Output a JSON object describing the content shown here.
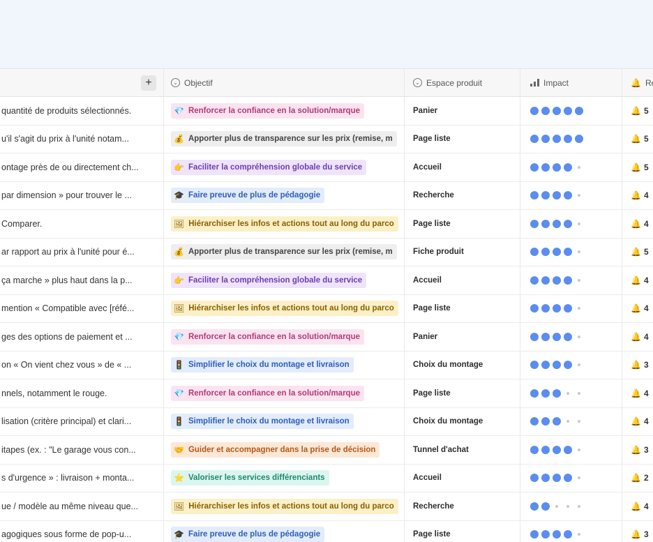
{
  "header": {
    "add_label": "+",
    "objectif": "Objectif",
    "espace": "Espace produit",
    "impact": "Impact",
    "re": "Re"
  },
  "icons": {
    "objectif": "circle-chevron-icon",
    "espace": "circle-chevron-icon",
    "impact": "bar-chart-icon",
    "re": "bell-icon"
  },
  "colors": {
    "accent_dot": "#5b8def",
    "top_band": "#f1f5fc"
  },
  "rows": [
    {
      "desc": "quantité de produits sélectionnés.",
      "emoji": "💎",
      "objectif": "Renforcer la confiance en la solution/marque",
      "tag_bg": "#fbe4ef",
      "tag_fg": "#b23b76",
      "espace": "Panier",
      "impact": 5,
      "re": "5"
    },
    {
      "desc": "u'il s'agit du prix à l'unité notam...",
      "emoji": "💰",
      "objectif": "Apporter plus de transparence sur les prix (remise, m",
      "tag_bg": "#eeeeee",
      "tag_fg": "#444444",
      "espace": "Page liste",
      "impact": 5,
      "re": "5"
    },
    {
      "desc": "ontage près de ou directement ch...",
      "emoji": "👉",
      "objectif": "Faciliter la compréhension globale du service",
      "tag_bg": "#efe4fb",
      "tag_fg": "#6b3fb3",
      "espace": "Accueil",
      "impact": 4,
      "re": "5"
    },
    {
      "desc": "par dimension » pour trouver le ...",
      "emoji": "🎓",
      "objectif": "Faire preuve de plus de pédagogie",
      "tag_bg": "#e3ecfb",
      "tag_fg": "#2d5fb8",
      "espace": "Recherche",
      "impact": 4,
      "re": "4"
    },
    {
      "desc": "Comparer.",
      "emoji": "🖼",
      "objectif": "Hiérarchiser les infos et actions tout au long du parco",
      "tag_bg": "#fcf0c8",
      "tag_fg": "#8a6200",
      "espace": "Page liste",
      "impact": 4,
      "re": "4"
    },
    {
      "desc": "ar rapport au prix à l'unité pour é...",
      "emoji": "💰",
      "objectif": "Apporter plus de transparence sur les prix (remise, m",
      "tag_bg": "#eeeeee",
      "tag_fg": "#444444",
      "espace": "Fiche produit",
      "impact": 4,
      "re": "5"
    },
    {
      "desc": "ça marche » plus haut dans la p...",
      "emoji": "👉",
      "objectif": "Faciliter la compréhension globale du service",
      "tag_bg": "#efe4fb",
      "tag_fg": "#6b3fb3",
      "espace": "Accueil",
      "impact": 4,
      "re": "4"
    },
    {
      "desc": "mention « Compatible avec [réfé...",
      "emoji": "🖼",
      "objectif": "Hiérarchiser les infos et actions tout au long du parco",
      "tag_bg": "#fcf0c8",
      "tag_fg": "#8a6200",
      "espace": "Page liste",
      "impact": 4,
      "re": "4"
    },
    {
      "desc": "ges des options de paiement et ...",
      "emoji": "💎",
      "objectif": "Renforcer la confiance en la solution/marque",
      "tag_bg": "#fbe4ef",
      "tag_fg": "#b23b76",
      "espace": "Panier",
      "impact": 4,
      "re": "4"
    },
    {
      "desc": "on « On vient chez vous » de « ...",
      "emoji": "🚦",
      "objectif": "Simplifier le choix du montage et livraison",
      "tag_bg": "#e3ecfb",
      "tag_fg": "#2d5fb8",
      "espace": "Choix du montage",
      "impact": 4,
      "re": "3"
    },
    {
      "desc": "nnels, notamment le rouge.",
      "emoji": "💎",
      "objectif": "Renforcer la confiance en la solution/marque",
      "tag_bg": "#fbe4ef",
      "tag_fg": "#b23b76",
      "espace": "Page liste",
      "impact": 3,
      "re": "4"
    },
    {
      "desc": "lisation (critère principal) et clari...",
      "emoji": "🚦",
      "objectif": "Simplifier le choix du montage et livraison",
      "tag_bg": "#e3ecfb",
      "tag_fg": "#2d5fb8",
      "espace": "Choix du montage",
      "impact": 3,
      "re": "4"
    },
    {
      "desc": "itapes (ex. : \"Le garage vous con...",
      "emoji": "🤝",
      "objectif": "Guider et accompagner dans la prise de décision",
      "tag_bg": "#fde7d6",
      "tag_fg": "#b25a1a",
      "espace": "Tunnel d'achat",
      "impact": 4,
      "re": "3"
    },
    {
      "desc": "s d'urgence » : livraison + monta...",
      "emoji": "⭐",
      "objectif": "Valoriser les services différenciants",
      "tag_bg": "#dcf5ef",
      "tag_fg": "#1f8a6e",
      "espace": "Accueil",
      "impact": 4,
      "re": "2"
    },
    {
      "desc": "ue / modèle au même niveau que...",
      "emoji": "🖼",
      "objectif": "Hiérarchiser les infos et actions tout au long du parco",
      "tag_bg": "#fcf0c8",
      "tag_fg": "#8a6200",
      "espace": "Recherche",
      "impact": 2,
      "re": "4"
    },
    {
      "desc": "agogiques sous forme de pop-u...",
      "emoji": "🎓",
      "objectif": "Faire preuve de plus de pédagogie",
      "tag_bg": "#e3ecfb",
      "tag_fg": "#2d5fb8",
      "espace": "Page liste",
      "impact": 4,
      "re": "3"
    }
  ]
}
